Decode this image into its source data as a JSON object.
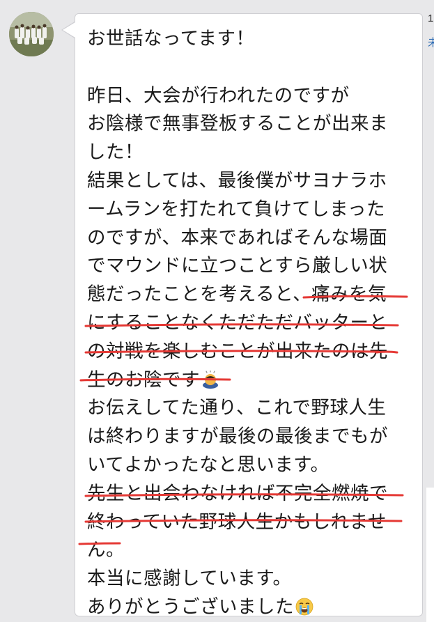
{
  "chat": {
    "side_time_partial": "1",
    "side_read_partial": "未",
    "message_lines": [
      "お世話なってます！",
      "",
      "昨日、大会が行われたのですが",
      "お陰様で無事登板することが出来ま",
      "した！",
      "結果としては、最後僕がサヨナラホ",
      "ームランを打たれて負けてしまった",
      "のですが、本来であればそんな場面",
      "でマウンドに立つことすら厳しい状",
      "態だったことを考えると、痛みを気",
      "にすることなくただただバッターと",
      "の対戦を楽しむことが出来たのは先",
      "生のお陰です",
      "お伝えしてた通り、これで野球人生",
      "は終わりますが最後の最後までもが",
      "いてよかったなと思います。",
      "先生と出会わなければ不完全燃焼で",
      "終わっていた野球人生かもしれませ",
      "ん。",
      "本当に感謝しています。",
      "ありがとうございました"
    ],
    "emoji": {
      "bowing": "bowing-person-emoji",
      "crying": "loudly-crying-face-emoji"
    },
    "colors": {
      "underline": "#e53935",
      "bubble_bg": "#ffffff",
      "background": "#e8e8ea",
      "read_label": "#2f6db5"
    }
  }
}
